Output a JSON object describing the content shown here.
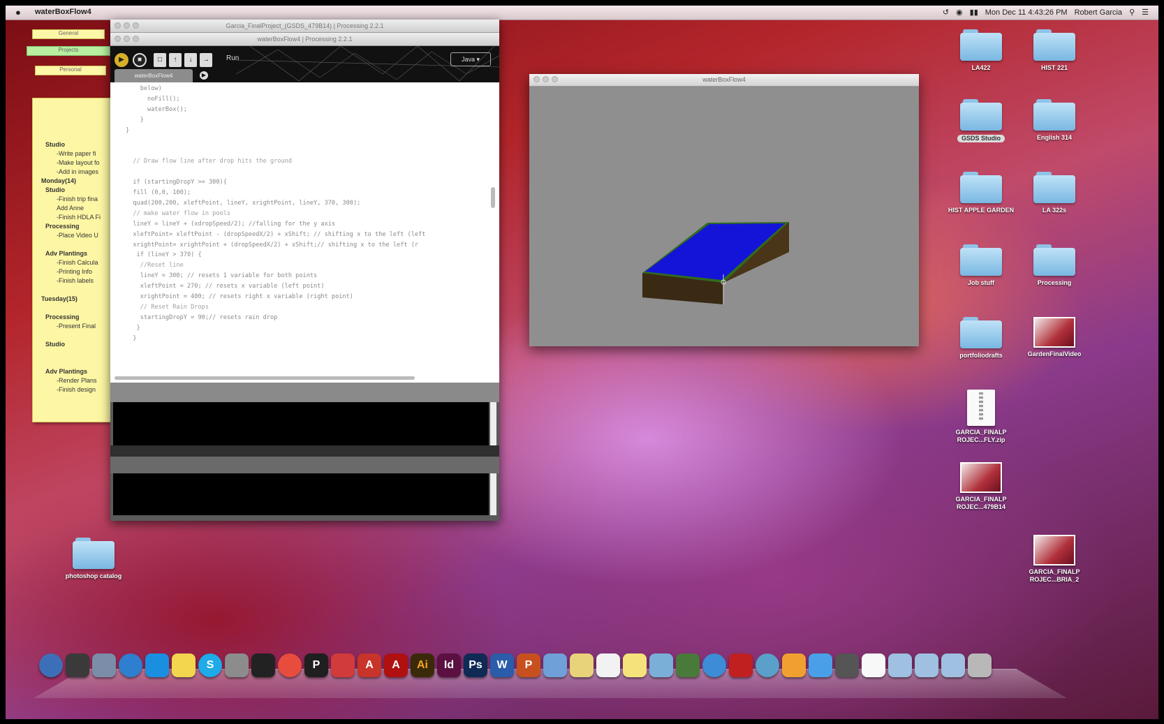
{
  "menubar": {
    "apple": "",
    "app_name": "waterBoxFlow4",
    "clock": "Mon Dec 11 4:43:26 PM",
    "user": "Robert Garcia"
  },
  "editor": {
    "title1": "Garcia_FinalProject_(GSDS_479B14) | Processing 2.2.1",
    "title2": "waterBoxFlow4 | Processing 2.2.1",
    "run_label": "Run",
    "mode": "Java",
    "tab_name": "waterBoxFlow4",
    "code_lines": [
      "    below)",
      "      noFill();",
      "      waterBox();",
      "    }",
      "}",
      "",
      "",
      "  // Draw flow line after drop hits the ground",
      "",
      "  if (startingDropY >= 300){",
      "  fill (0,0, 100);",
      "  quad(200,200, xleftPoint, lineY, xrightPoint, lineY, 370, 300);",
      "  // make water flow in pools",
      "  lineY = lineY + (xdropSpeed/2); //falling for the y axis",
      "  xleftPoint= xleftPoint - (dropSpeedX/2) + xShift; // shifting x to the left (left",
      "  xrightPoint= xrightPoint + (dropSpeedX/2) + xShift;// shifting x to the left (r",
      "   if (lineY > 370) {",
      "    //Reset line",
      "    lineY = 300; // resets 1 variable for both points",
      "    xleftPoint = 270; // resets x variable (left point)",
      "    xrightPoint = 400; // resets right x variable (right point)",
      "    // Reset Rain Drops",
      "    startingDropY = 90;// resets rain drop",
      "   }",
      "  }"
    ]
  },
  "sketch": {
    "title": "waterBoxFlow4"
  },
  "sticky": {
    "tabs": [
      "General",
      "Projects",
      "Personal"
    ],
    "lines": [
      {
        "text": "Studio",
        "cls": "h i1"
      },
      {
        "text": "-Write paper fi",
        "cls": "i2"
      },
      {
        "text": "-Make layout fo",
        "cls": "i2"
      },
      {
        "text": "-Add in images",
        "cls": "i2"
      },
      {
        "text": "Monday(14)",
        "cls": "h"
      },
      {
        "text": "Studio",
        "cls": "h i1"
      },
      {
        "text": "-Finish trip fina",
        "cls": "i2"
      },
      {
        "text": "  Add Anne",
        "cls": "i2"
      },
      {
        "text": "-Finish HDLA Fi",
        "cls": "i2"
      },
      {
        "text": "Processing",
        "cls": "h i1"
      },
      {
        "text": "-Place Video U",
        "cls": "i2"
      },
      {
        "text": "",
        "cls": ""
      },
      {
        "text": "Adv Plantings",
        "cls": "h i1"
      },
      {
        "text": "-Finish Calcula",
        "cls": "i2"
      },
      {
        "text": "-Printing Info",
        "cls": "i2"
      },
      {
        "text": "-Finish labels",
        "cls": "i2"
      },
      {
        "text": "",
        "cls": ""
      },
      {
        "text": "Tuesday(15)",
        "cls": "h"
      },
      {
        "text": "",
        "cls": ""
      },
      {
        "text": "Processing",
        "cls": "h i1"
      },
      {
        "text": "-Present Final",
        "cls": "i2"
      },
      {
        "text": "",
        "cls": ""
      },
      {
        "text": "Studio",
        "cls": "h i1"
      },
      {
        "text": "",
        "cls": ""
      },
      {
        "text": "",
        "cls": ""
      },
      {
        "text": "Adv Plantings",
        "cls": "h i1"
      },
      {
        "text": "-Render Plans",
        "cls": "i2"
      },
      {
        "text": "-Finish design",
        "cls": "i2"
      }
    ]
  },
  "desktop": {
    "icons": [
      {
        "name": "LA422",
        "kind": "folder"
      },
      {
        "name": "HIST 221",
        "kind": "folder"
      },
      {
        "name": "GSDS Studio",
        "kind": "folder"
      },
      {
        "name": "English 314",
        "kind": "folder"
      },
      {
        "name": "HIST APPLE GARDEN",
        "kind": "folder"
      },
      {
        "name": "LA 322s",
        "kind": "folder"
      },
      {
        "name": "Job stuff",
        "kind": "folder"
      },
      {
        "name": "Processing",
        "kind": "folder"
      },
      {
        "name": "portfoliodrafts",
        "kind": "folder"
      },
      {
        "name": "GardenFinalVideo",
        "kind": "image"
      },
      {
        "name": "GARCIA_FINALP ROJEC...FLY.zip",
        "kind": "zip"
      },
      {
        "name": "GARCIA_FINALP ROJEC...479B14",
        "kind": "image"
      },
      {
        "name": "GARCIA_FINALP ROJEC...BRIA_2",
        "kind": "image"
      },
      {
        "name": "photoshop catalog",
        "kind": "folder"
      }
    ]
  },
  "colors": {
    "water": "#1414d8",
    "dirt": "#3a2a14",
    "grass": "#2f6b1e",
    "sketch_bg": "#8f8f8f"
  },
  "dock": {
    "icons": [
      "finder-icon",
      "dashboard-icon",
      "mail-icon",
      "safari-icon",
      "app-store-icon",
      "stickies-icon",
      "skype-icon",
      "system-prefs-icon",
      "terminal-icon",
      "chrome-icon",
      "processing-icon",
      "sketchup-icon",
      "autocad-icon",
      "acrobat-icon",
      "illustrator-icon",
      "indesign-icon",
      "photoshop-icon",
      "word-icon",
      "powerpoint-icon",
      "preview-icon",
      "notes-icon",
      "calendar-icon",
      "stickies2-icon",
      "photos-icon",
      "facetime-icon",
      "itunes-icon",
      "flash-icon",
      "maps-icon",
      "ichat-icon",
      "app-icon",
      "screens-icon",
      "textedit-icon",
      "downloads-icon",
      "documents-icon",
      "folder-icon",
      "trash-icon"
    ]
  }
}
